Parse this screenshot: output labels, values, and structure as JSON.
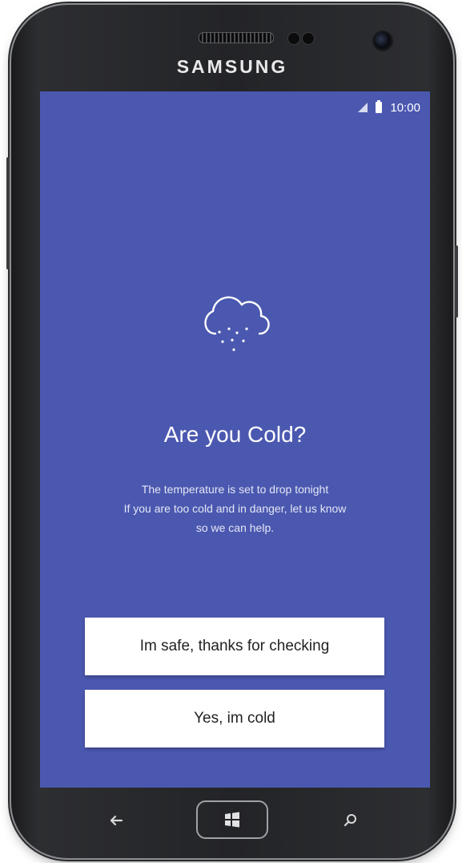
{
  "device": {
    "brand": "SAMSUNG"
  },
  "status_bar": {
    "time": "10:00",
    "signal_icon": "signal-icon",
    "battery_icon": "battery-icon"
  },
  "main": {
    "icon": "cloud-snow-icon",
    "title": "Are you Cold?",
    "description": [
      "The temperature is set to drop tonight",
      "If you are too cold and in danger, let us know",
      "so we can help."
    ],
    "buttons": {
      "safe_label": "Im safe, thanks for checking",
      "cold_label": "Yes, im cold"
    }
  },
  "nav_bar": {
    "back_icon": "back-arrow-icon",
    "home_icon": "windows-icon",
    "search_icon": "search-icon"
  },
  "colors": {
    "screen_background": "#4b58b0",
    "button_background": "#ffffff",
    "text_primary": "#ffffff"
  }
}
